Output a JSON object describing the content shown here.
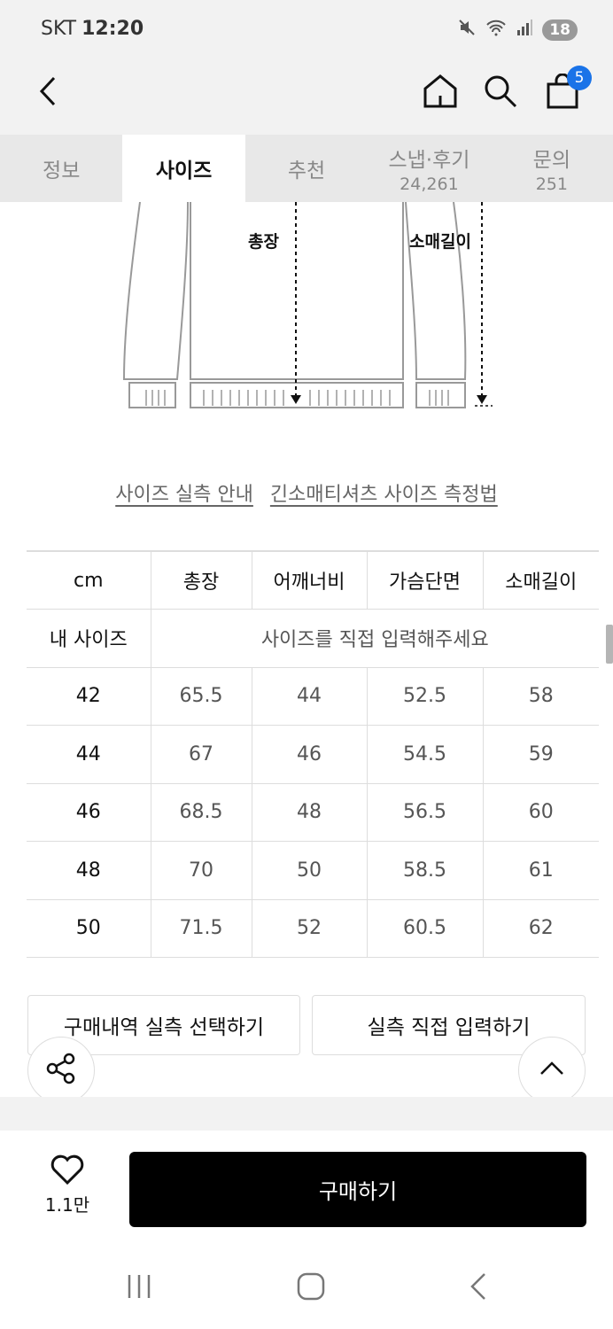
{
  "status_bar": {
    "carrier": "SKT",
    "time": "12:20",
    "battery": "18"
  },
  "header": {
    "cart_count": "5"
  },
  "tabs": [
    {
      "label": "정보",
      "sub": ""
    },
    {
      "label": "사이즈",
      "sub": ""
    },
    {
      "label": "추천",
      "sub": ""
    },
    {
      "label": "스냅·후기",
      "sub": "24,261"
    },
    {
      "label": "문의",
      "sub": "251"
    }
  ],
  "diagram": {
    "total_length": "총장",
    "sleeve_length": "소매길이"
  },
  "links": {
    "size_guide": "사이즈 실측 안내",
    "measure_method": "긴소매티셔츠 사이즈 측정법"
  },
  "size_table": {
    "headers": [
      "cm",
      "총장",
      "어깨너비",
      "가슴단면",
      "소매길이"
    ],
    "my_size_label": "내 사이즈",
    "my_size_prompt": "사이즈를 직접 입력해주세요",
    "rows": [
      [
        "42",
        "65.5",
        "44",
        "52.5",
        "58"
      ],
      [
        "44",
        "67",
        "46",
        "54.5",
        "59"
      ],
      [
        "46",
        "68.5",
        "48",
        "56.5",
        "60"
      ],
      [
        "48",
        "70",
        "50",
        "58.5",
        "61"
      ],
      [
        "50",
        "71.5",
        "52",
        "60.5",
        "62"
      ]
    ]
  },
  "actions": {
    "select_purchase": "구매내역 실측 선택하기",
    "manual_input": "실측 직접 입력하기"
  },
  "bottom": {
    "like_count": "1.1만",
    "buy_label": "구매하기"
  }
}
